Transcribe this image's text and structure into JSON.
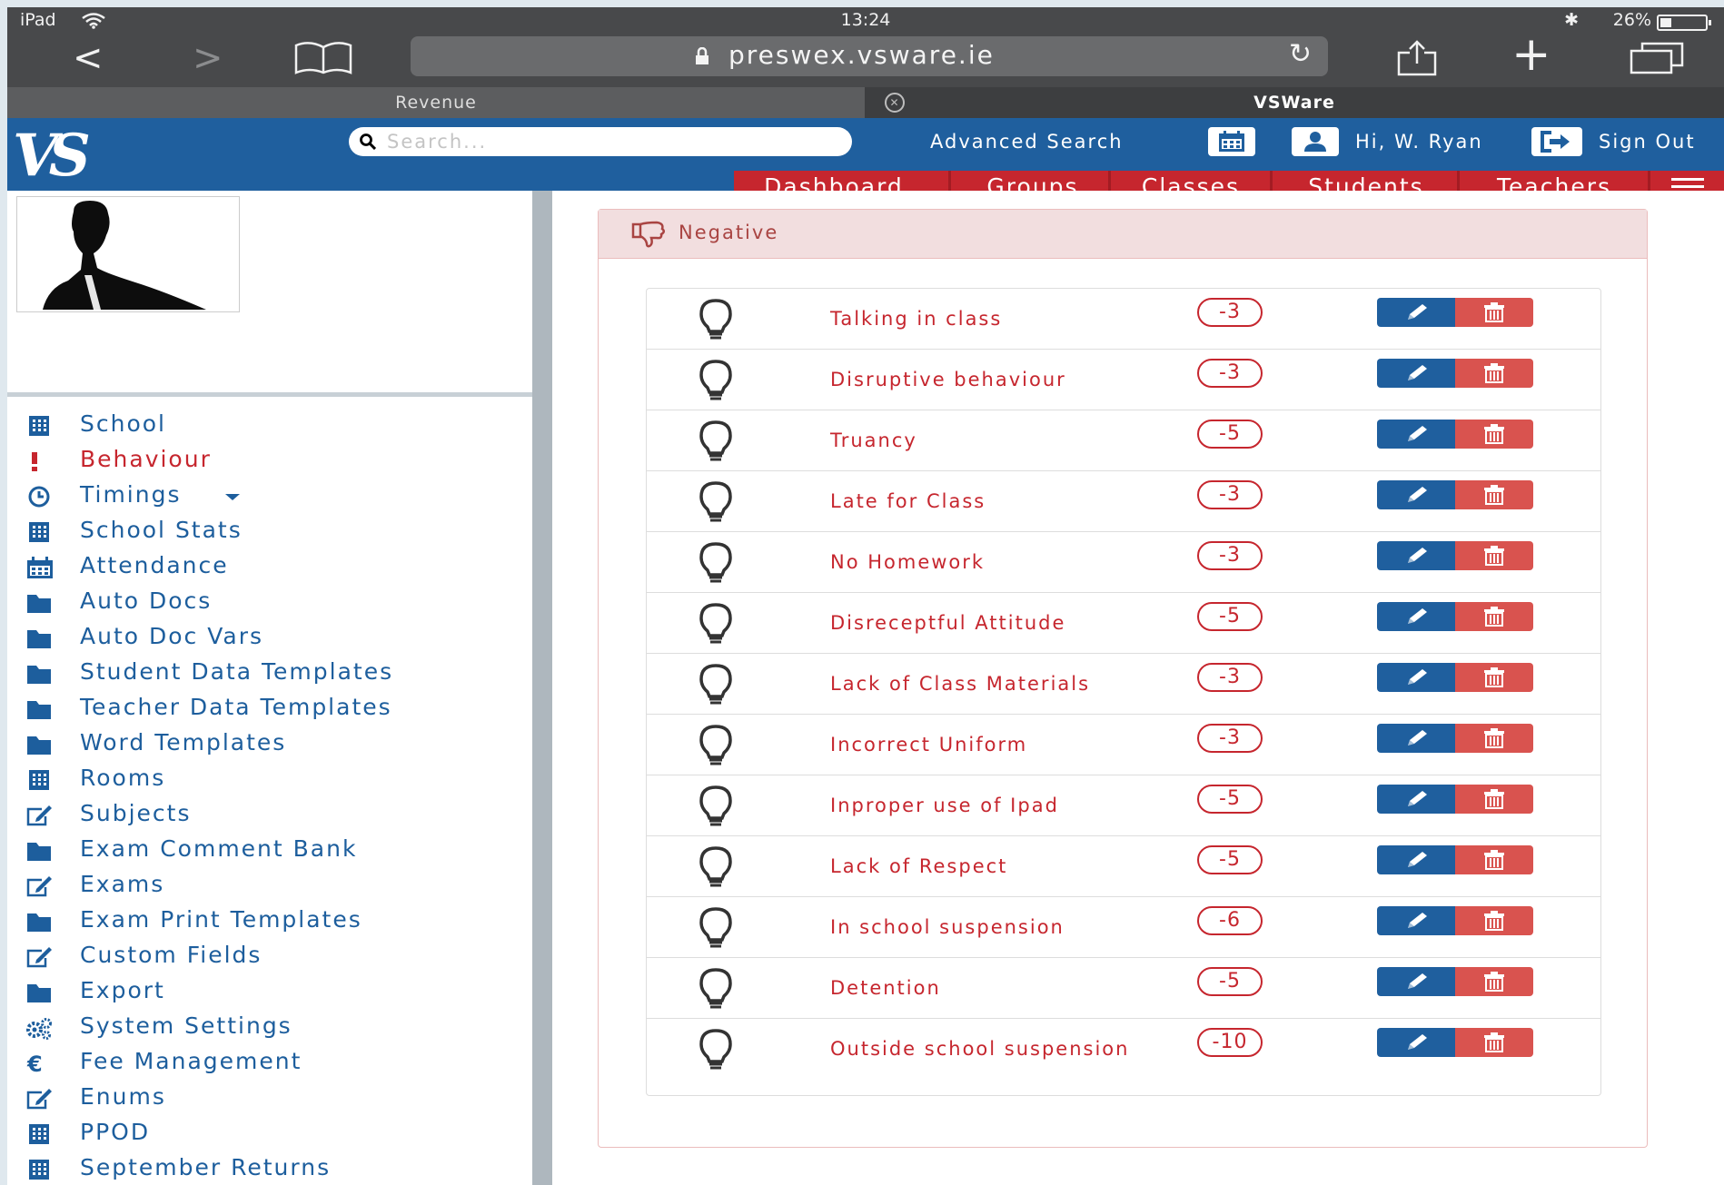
{
  "status_bar": {
    "device": "iPad",
    "time": "13:24",
    "battery": "26%",
    "icons": [
      "wifi-icon",
      "bluetooth-icon",
      "battery-icon"
    ]
  },
  "browser": {
    "url": "preswex.vsware.ie",
    "tabs": [
      {
        "label": "Revenue"
      },
      {
        "label": "VSWare"
      }
    ],
    "icons": [
      "back-icon",
      "forward-icon",
      "bookmarks-icon",
      "lock-icon",
      "reload-icon",
      "share-icon",
      "new-tab-icon",
      "tabs-icon",
      "tab-close-icon"
    ]
  },
  "header": {
    "logo": "VS",
    "search_placeholder": "Search...",
    "advanced_search": "Advanced Search",
    "greeting": "Hi, W. Ryan",
    "sign_out": "Sign Out",
    "menu": [
      {
        "label": "Dashboard"
      },
      {
        "label": "Groups"
      },
      {
        "label": "Classes"
      },
      {
        "label": "Students"
      },
      {
        "label": "Teachers"
      }
    ],
    "colors": {
      "primary": "#1f5f9e",
      "menu_red": "#c6262e"
    }
  },
  "sidebar": {
    "items": [
      {
        "label": "School",
        "icon": "building-icon"
      },
      {
        "label": "Behaviour",
        "icon": "exclamation-icon",
        "active": true
      },
      {
        "label": "Timings",
        "icon": "clock-icon",
        "dropdown": true
      },
      {
        "label": "School Stats",
        "icon": "building-icon"
      },
      {
        "label": "Attendance",
        "icon": "calendar-icon"
      },
      {
        "label": "Auto Docs",
        "icon": "folder-icon"
      },
      {
        "label": "Auto Doc Vars",
        "icon": "folder-icon"
      },
      {
        "label": "Student Data Templates",
        "icon": "folder-icon"
      },
      {
        "label": "Teacher Data Templates",
        "icon": "folder-icon"
      },
      {
        "label": "Word Templates",
        "icon": "folder-icon"
      },
      {
        "label": "Rooms",
        "icon": "building-icon"
      },
      {
        "label": "Subjects",
        "icon": "edit-icon"
      },
      {
        "label": "Exam Comment Bank",
        "icon": "folder-icon"
      },
      {
        "label": "Exams",
        "icon": "edit-icon"
      },
      {
        "label": "Exam Print Templates",
        "icon": "folder-icon"
      },
      {
        "label": "Custom Fields",
        "icon": "edit-icon"
      },
      {
        "label": "Export",
        "icon": "folder-icon"
      },
      {
        "label": "System Settings",
        "icon": "gears-icon"
      },
      {
        "label": "Fee Management",
        "icon": "euro-icon"
      },
      {
        "label": "Enums",
        "icon": "edit-icon"
      },
      {
        "label": "PPOD",
        "icon": "building-icon"
      },
      {
        "label": "September Returns",
        "icon": "building-icon"
      }
    ]
  },
  "panel": {
    "title": "Negative",
    "icon": "thumbs-down-icon",
    "rows": [
      {
        "label": "Talking in class",
        "points": "-3"
      },
      {
        "label": "Disruptive behaviour",
        "points": "-3"
      },
      {
        "label": "Truancy",
        "points": "-5"
      },
      {
        "label": "Late for Class",
        "points": "-3"
      },
      {
        "label": "No Homework",
        "points": "-3"
      },
      {
        "label": "Disreceptful Attitude",
        "points": "-5"
      },
      {
        "label": "Lack of Class Materials",
        "points": "-3"
      },
      {
        "label": "Incorrect Uniform",
        "points": "-3"
      },
      {
        "label": "Inproper use of Ipad",
        "points": "-5"
      },
      {
        "label": "Lack of Respect",
        "points": "-5"
      },
      {
        "label": "In school suspension",
        "points": "-6"
      },
      {
        "label": "Detention",
        "points": "-5"
      },
      {
        "label": "Outside school suspension",
        "points": "-10"
      }
    ],
    "row_icons": [
      "lightbulb-icon",
      "pencil-icon",
      "trash-icon"
    ]
  }
}
